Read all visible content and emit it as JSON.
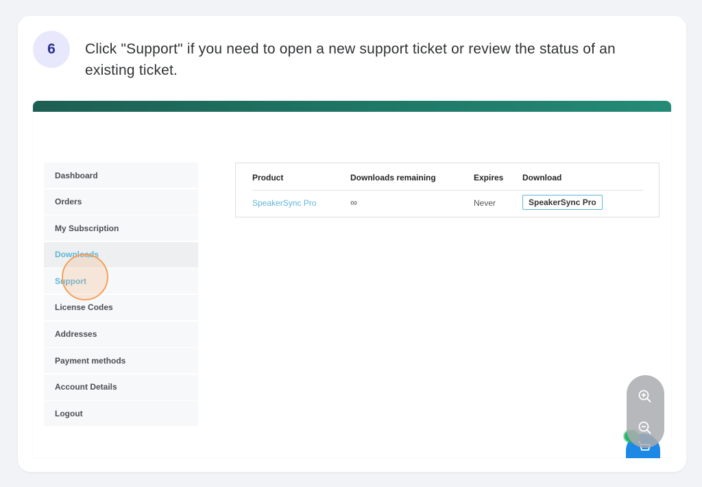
{
  "step": {
    "number": "6",
    "text": "Click \"Support\" if you need to open a new support ticket or review the status of an existing ticket."
  },
  "sidebar": {
    "items": [
      {
        "label": "Dashboard"
      },
      {
        "label": "Orders"
      },
      {
        "label": "My Subscription"
      },
      {
        "label": "Downloads",
        "state": "active"
      },
      {
        "label": "Support",
        "state": "hover"
      },
      {
        "label": "License Codes"
      },
      {
        "label": "Addresses"
      },
      {
        "label": "Payment methods"
      },
      {
        "label": "Account Details"
      },
      {
        "label": "Logout"
      }
    ]
  },
  "downloads_table": {
    "headers": [
      "Product",
      "Downloads remaining",
      "Expires",
      "Download"
    ],
    "rows": [
      {
        "product": "SpeakerSync Pro",
        "remaining": "∞",
        "expires": "Never",
        "download": "SpeakerSync Pro"
      }
    ]
  },
  "icons": {
    "zoom_in": "zoom-in-icon",
    "zoom_out": "zoom-out-icon",
    "cart": "cart-icon"
  },
  "colors": {
    "accent": "#5eb5d8",
    "header": "#1f7a68",
    "highlight": "#f3a05a",
    "cart": "#1e88e5"
  }
}
